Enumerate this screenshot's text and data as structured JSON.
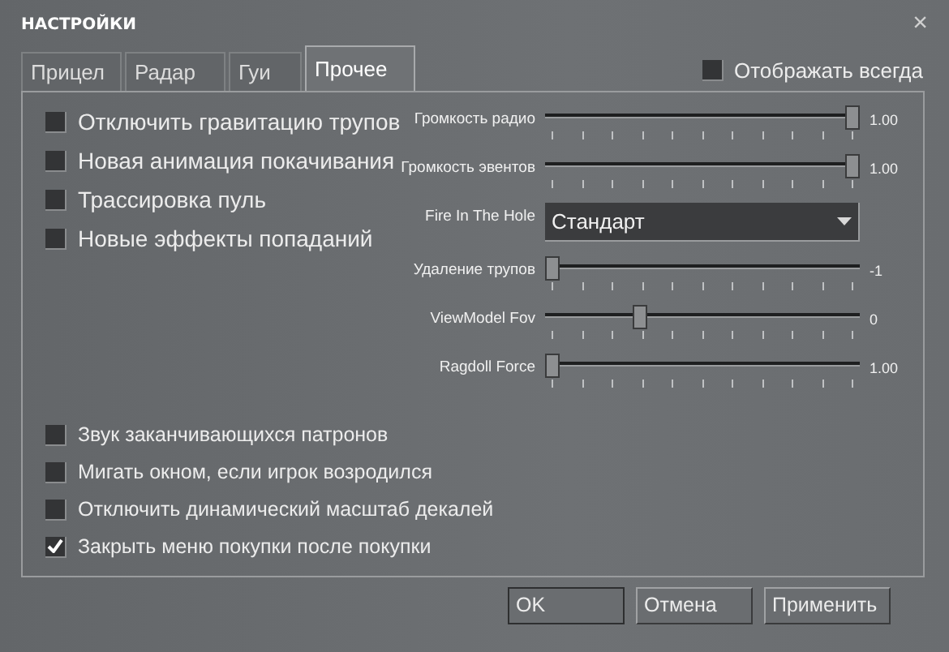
{
  "window": {
    "title": "НАСТРОЙКИ",
    "close": "×"
  },
  "tabs": [
    {
      "label": "Прицел",
      "selected": false
    },
    {
      "label": "Радар",
      "selected": false
    },
    {
      "label": "Гуи",
      "selected": false
    },
    {
      "label": "Прочее",
      "selected": true
    }
  ],
  "show_always": {
    "label": "Отображать всегда",
    "checked": false
  },
  "options_top": [
    {
      "label": "Отключить гравитацию трупов",
      "checked": false
    },
    {
      "label": "Новая анимация покачивания",
      "checked": false
    },
    {
      "label": "Трассировка пуль",
      "checked": false
    },
    {
      "label": "Новые эффекты попаданий",
      "checked": false
    }
  ],
  "controls": [
    {
      "kind": "slider",
      "label": "Громкость радио",
      "level": 1,
      "reading": "1.00"
    },
    {
      "kind": "slider",
      "label": "Громкость эвентов",
      "level": 1,
      "reading": "1.00"
    },
    {
      "kind": "dropdown",
      "label": "Fire In The Hole",
      "value": "Стандарт"
    },
    {
      "kind": "slider",
      "label": "Удаление трупов",
      "level": 0,
      "reading": "-1"
    },
    {
      "kind": "slider",
      "label": "ViewModel Fov",
      "level": 0.29,
      "reading": "0"
    },
    {
      "kind": "slider",
      "label": "Ragdoll Force",
      "level": 0,
      "reading": "1.00"
    }
  ],
  "options_bottom": [
    {
      "label": "Звук заканчивающихся патронов",
      "checked": false
    },
    {
      "label": "Мигать окном, если игрок возродился",
      "checked": false
    },
    {
      "label": "Отключить динамический масштаб декалей",
      "checked": false
    },
    {
      "label": "Закрыть меню покупки после покупки",
      "checked": true
    }
  ],
  "buttons": [
    {
      "label": "OK",
      "selected": true
    },
    {
      "label": "Отмена",
      "selected": false
    },
    {
      "label": "Применить",
      "selected": false
    }
  ]
}
